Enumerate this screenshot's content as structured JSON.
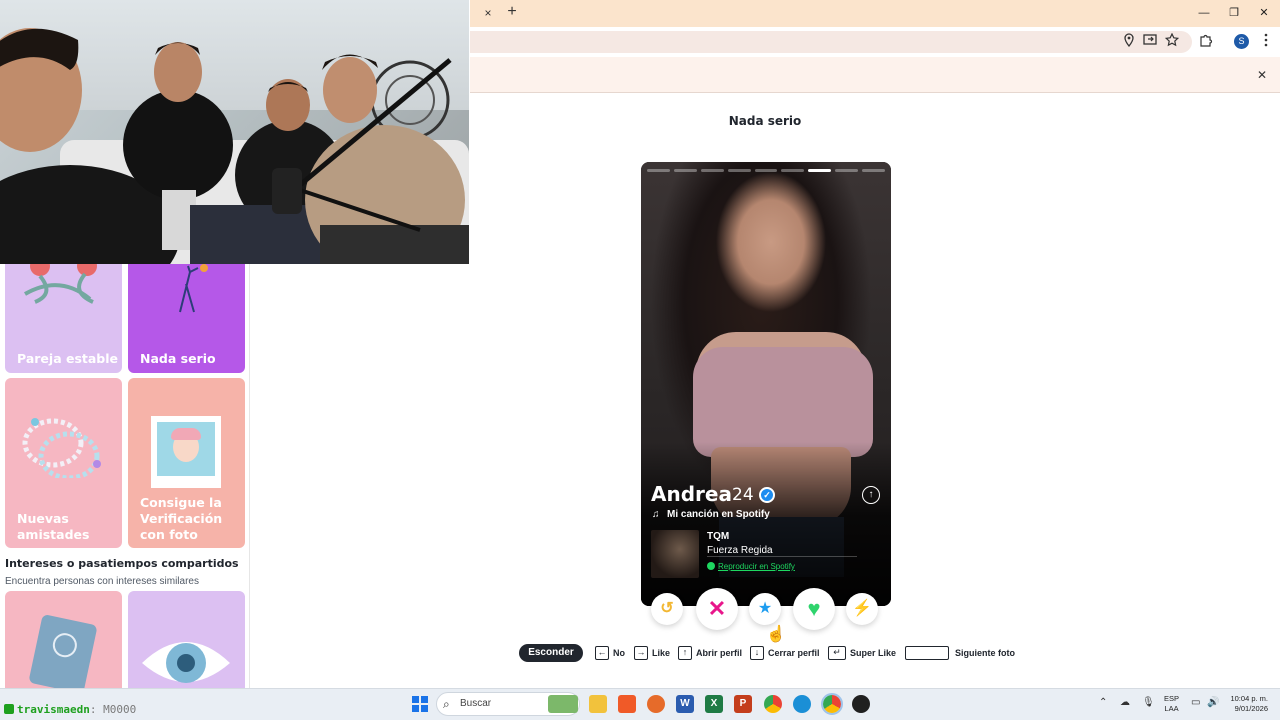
{
  "browser": {
    "tab_close": "×",
    "new_tab": "+",
    "win_min": "—",
    "win_restore": "❐",
    "win_close": "✕",
    "profile_initial": "S",
    "infobar_close": "✕"
  },
  "main": {
    "page_title": "Nada serio"
  },
  "sidebar": {
    "cards": [
      {
        "label": "Pareja estable",
        "color": "#dcc0f2"
      },
      {
        "label": "Nada serio",
        "color": "#b558e8"
      },
      {
        "label": "Nuevas amistades",
        "color": "#f6b7c2"
      },
      {
        "label": "Consigue la Verificación con foto",
        "color": "#f6b3a9"
      }
    ],
    "section_title": "Intereses o pasatiempos compartidos",
    "section_subtitle": "Encuentra personas con intereses similares"
  },
  "profile": {
    "name": "Andrea",
    "age": "24",
    "verified_icon": "✓",
    "expand_icon": "↑",
    "spotify_heading": "Mi canción en Spotify",
    "song_title": "TQM",
    "song_artist": "Fuerza Regida",
    "play_link": "Reproducir en Spotify",
    "photo_count": 9,
    "active_photo": 7
  },
  "actions": {
    "rewind_icon": "↺",
    "nope_icon": "✕",
    "superlike_icon": "★",
    "like_icon": "♥",
    "boost_icon": "⚡"
  },
  "shortcuts": {
    "hide_button": "Esconder",
    "no_label": "No",
    "like_label": "Like",
    "open_label": "Abrir perfil",
    "close_label": "Cerrar perfil",
    "superlike_label": "Super Like",
    "next_photo_label": "Siguiente foto",
    "key_left": "←",
    "key_right": "→",
    "key_up": "↑",
    "key_down": "↓",
    "key_enter": "↵"
  },
  "taskbar": {
    "stream_user": "travismaedn",
    "stream_text": ": M0000",
    "search_placeholder": "Buscar",
    "lang_1": "ESP",
    "lang_2": "LAA",
    "time": "10:04 p. m.",
    "date": "9/01/2026"
  },
  "colors": {
    "accent": "#fd267d",
    "nope": "#e8168b",
    "superlike": "#1e9df0",
    "like": "#2fd46d",
    "boost": "#a93cf6",
    "rewind": "#f2b733"
  }
}
